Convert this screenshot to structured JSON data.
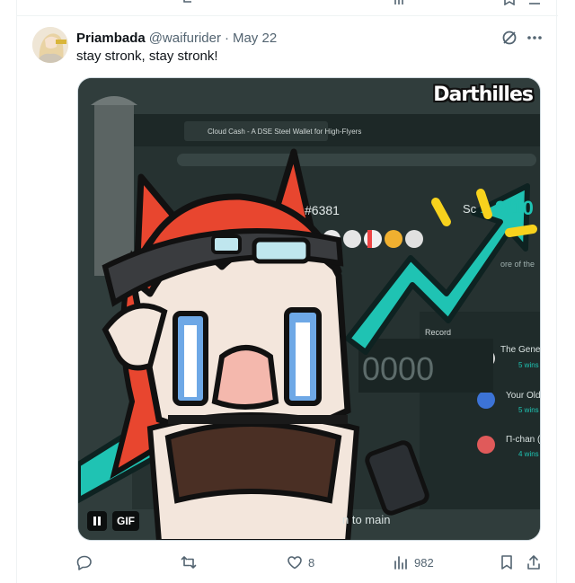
{
  "tweet": {
    "author_name": "Priambada",
    "handle": "@waifurider",
    "separator": "·",
    "date": "May 22",
    "text": "stay stronk, stay stronk!"
  },
  "media": {
    "type": "gif",
    "badge_label": "GIF",
    "watermark": "Darthilles",
    "scene_text": {
      "browser_tab": "Cloud Cash - A DSE Steel Wallet for High-Flyers",
      "token_id": "#6381",
      "score": "9/10",
      "score_prefix": "Sc",
      "side_text": "ore of the",
      "record_label": "Record",
      "big_number": "0000",
      "list_item_1": "The General",
      "list_item_1_sub": "5 wins",
      "list_item_2": "Your Old F",
      "list_item_2_sub": "5 wins",
      "list_item_3": "Π-chan (u",
      "list_item_3_sub": "4 wins",
      "bottom_text": "n to main"
    }
  },
  "actions": {
    "reply_count": "",
    "repost_count": "",
    "like_count": "8",
    "views_count": "982"
  },
  "icons": {
    "reply": "reply-icon",
    "repost": "repost-icon",
    "like": "heart-icon",
    "views": "views-icon",
    "bookmark": "bookmark-icon",
    "share": "share-icon",
    "grok": "grok-icon",
    "more": "more-icon",
    "pause": "pause-icon"
  },
  "colors": {
    "text_primary": "#0f1419",
    "text_secondary": "#536471",
    "border": "#eff3f4",
    "teal_arrow": "#1fc3b3",
    "hair_red": "#e8462f"
  }
}
